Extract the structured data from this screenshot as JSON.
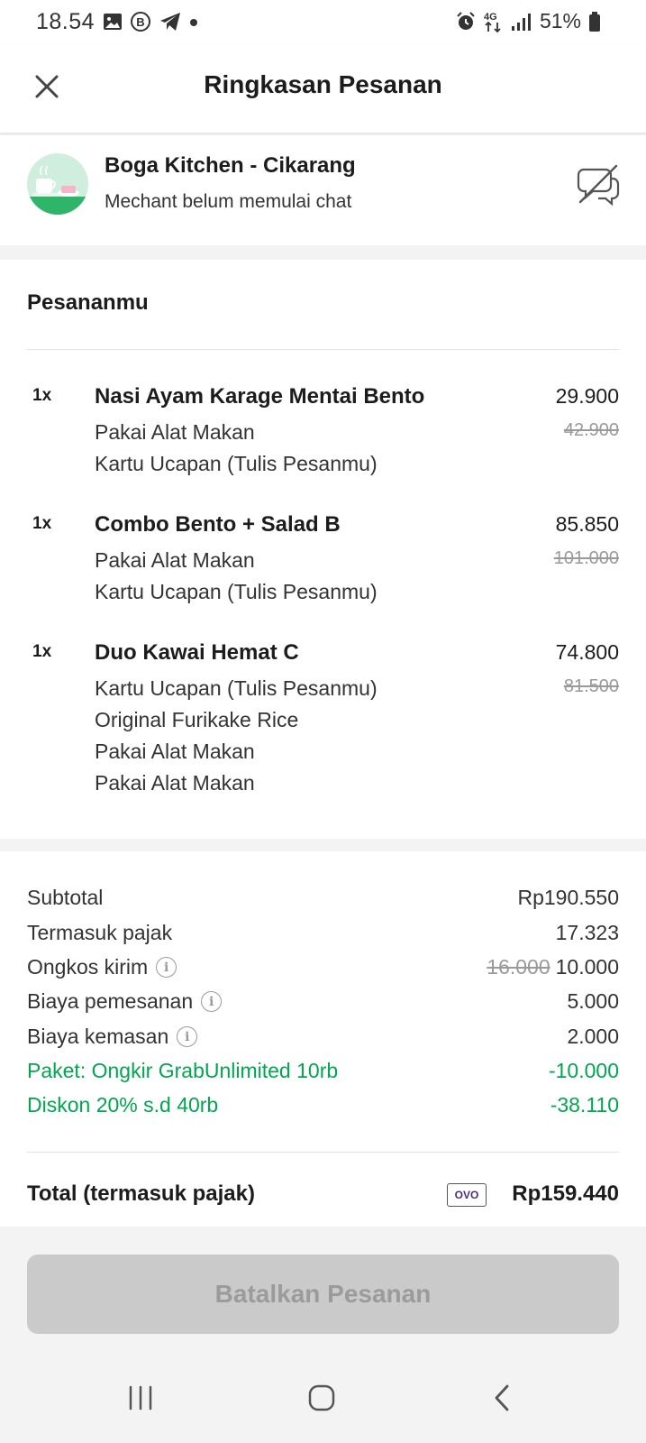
{
  "status_bar": {
    "time": "18.54",
    "icons_left": [
      "gallery-icon",
      "b-badge-icon",
      "telegram-icon",
      "dot-icon"
    ],
    "icons_right": [
      "alarm-icon",
      "4g-icon",
      "signal-icon"
    ],
    "battery": "51%"
  },
  "header": {
    "title": "Ringkasan Pesanan",
    "close_icon": "close-icon"
  },
  "merchant": {
    "name": "Boga Kitchen - Cikarang",
    "status": "Mechant belum memulai chat",
    "chat_icon": "chat-disabled-icon"
  },
  "order": {
    "heading": "Pesananmu",
    "items": [
      {
        "qty": "1x",
        "name": "Nasi Ayam Karage Mentai Bento",
        "price": "29.900",
        "old_price": "42.900",
        "options": [
          "Pakai Alat Makan",
          "Kartu Ucapan (Tulis Pesanmu)"
        ]
      },
      {
        "qty": "1x",
        "name": "Combo Bento + Salad B",
        "price": "85.850",
        "old_price": "101.000",
        "options": [
          "Pakai Alat Makan",
          "Kartu Ucapan (Tulis Pesanmu)"
        ]
      },
      {
        "qty": "1x",
        "name": "Duo Kawai Hemat C",
        "price": "74.800",
        "old_price": "81.500",
        "options": [
          "Kartu Ucapan (Tulis Pesanmu)",
          "Original Furikake Rice",
          "Pakai Alat Makan",
          "Pakai Alat Makan"
        ]
      }
    ]
  },
  "summary": {
    "subtotal_label": "Subtotal",
    "subtotal_value": "Rp190.550",
    "tax_label": "Termasuk pajak",
    "tax_value": "17.323",
    "delivery_label": "Ongkos kirim",
    "delivery_old": "16.000",
    "delivery_value": "10.000",
    "order_fee_label": "Biaya pemesanan",
    "order_fee_value": "5.000",
    "packaging_label": "Biaya kemasan",
    "packaging_value": "2.000",
    "promo1_label": "Paket: Ongkir GrabUnlimited 10rb",
    "promo1_value": "-10.000",
    "promo2_label": "Diskon 20% s.d 40rb",
    "promo2_value": "-38.110",
    "total_label": "Total (termasuk pajak)",
    "payment_badge": "OVO",
    "total_value": "Rp159.440",
    "info_glyph": "i"
  },
  "actions": {
    "cancel_label": "Batalkan Pesanan"
  },
  "colors": {
    "green": "#00a650",
    "disabled_button": "#cacaca",
    "background": "#f3f3f3"
  }
}
